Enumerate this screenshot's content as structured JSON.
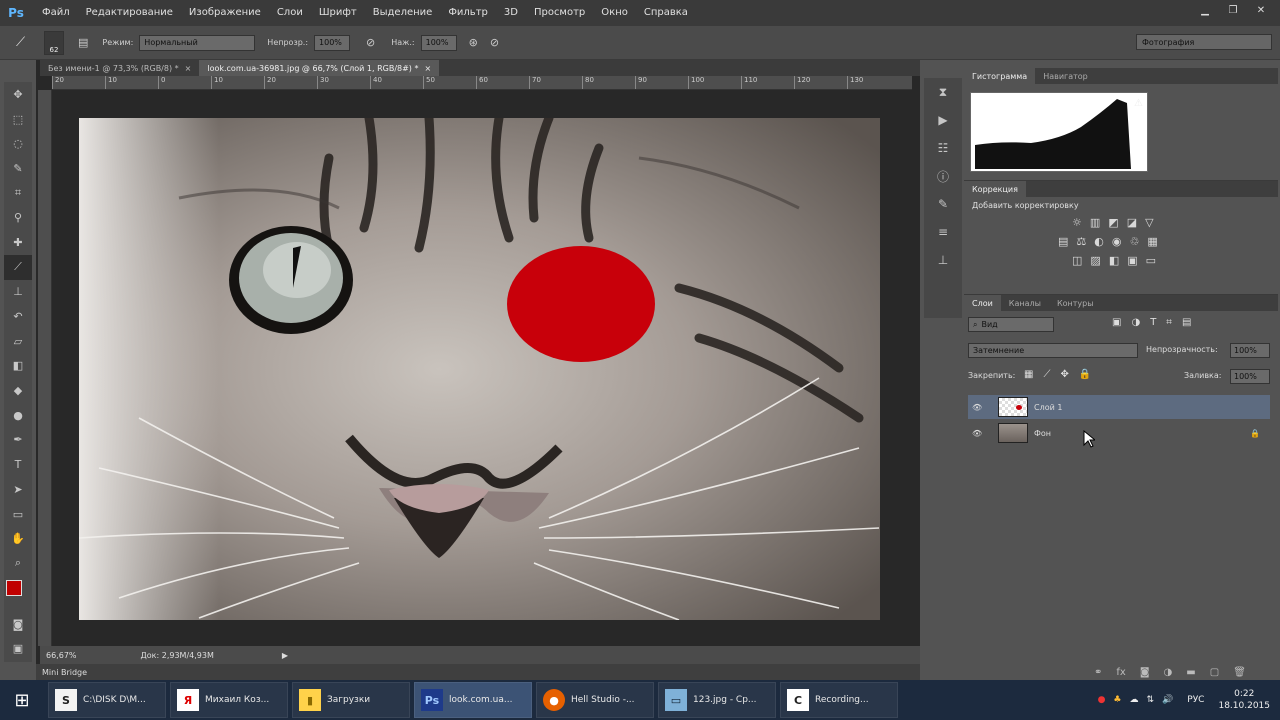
{
  "menubar": {
    "logo": "Ps",
    "items": [
      "Файл",
      "Редактирование",
      "Изображение",
      "Слои",
      "Шрифт",
      "Выделение",
      "Фильтр",
      "3D",
      "Просмотр",
      "Окно",
      "Справка"
    ]
  },
  "options": {
    "brush_size": "62",
    "mode_label": "Режим:",
    "mode_value": "Нормальный",
    "opacity_label": "Непрозр.:",
    "opacity_value": "100%",
    "flow_label": "Наж.:",
    "flow_value": "100%",
    "workspace": "Фотография"
  },
  "tabs": [
    {
      "label": "Без имени-1 @ 73,3% (RGB/8) *",
      "active": false
    },
    {
      "label": "look.com.ua-36981.jpg @ 66,7% (Слой 1, RGB/8#) *",
      "active": true
    }
  ],
  "ruler_h": [
    "20",
    "10",
    "0",
    "10",
    "20",
    "30",
    "40",
    "50",
    "60",
    "70",
    "80",
    "90",
    "100",
    "110",
    "120",
    "130"
  ],
  "status": {
    "zoom": "66,67%",
    "doc": "Док: 2,93M/4,93M"
  },
  "mini_bridge": "Mini Bridge",
  "histogram": {
    "tabs": [
      "Гистограмма",
      "Навигатор"
    ]
  },
  "adjustments": {
    "tab": "Коррекция",
    "title": "Добавить корректировку"
  },
  "layers_panel": {
    "tabs": [
      "Слои",
      "Каналы",
      "Контуры"
    ],
    "filter": "Вид",
    "blend_mode": "Затемнение",
    "opacity_label": "Непрозрачность:",
    "opacity_value": "100%",
    "lock_label": "Закрепить:",
    "fill_label": "Заливка:",
    "fill_value": "100%",
    "layers": [
      {
        "name": "Слой 1",
        "selected": true
      },
      {
        "name": "Фон",
        "selected": false
      }
    ]
  },
  "taskbar": {
    "items": [
      {
        "label": "C:\\DISK D\\M...",
        "icon": "S"
      },
      {
        "label": "Михаил Коз...",
        "icon": "Я"
      },
      {
        "label": "Загрузки",
        "icon": "▮"
      },
      {
        "label": "look.com.ua...",
        "icon": "Ps"
      },
      {
        "label": "Hell Studio -...",
        "icon": "●"
      },
      {
        "label": "123.jpg - Ср...",
        "icon": "▭"
      },
      {
        "label": "Recording...",
        "icon": "C"
      }
    ],
    "lang": "РУС",
    "time": "0:22",
    "date": "18.10.2015"
  },
  "colors": {
    "foreground": "#c00000",
    "background": "#111111",
    "brush": "#c8000a"
  }
}
